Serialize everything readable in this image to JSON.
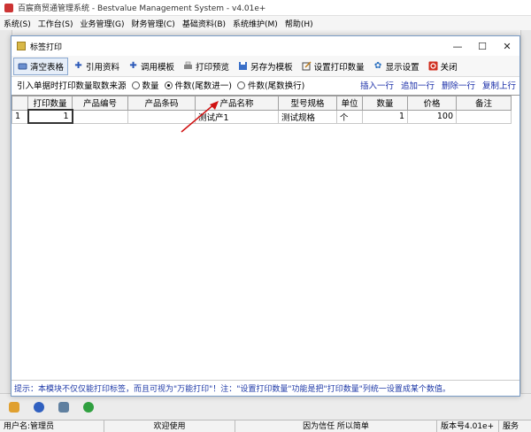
{
  "app": {
    "title": "百宸商贸通管理系统 - Bestvalue Management System - v4.01e+",
    "menu": [
      "系统(S)",
      "工作台(S)",
      "业务管理(G)",
      "财务管理(C)",
      "基础资料(B)",
      "系统维护(M)",
      "帮助(H)"
    ]
  },
  "dialog": {
    "title": "标签打印",
    "minimize": "—",
    "maximize": "☐",
    "close": "✕"
  },
  "toolbar": {
    "clear": "清空表格",
    "import": "引用资料",
    "template": "调用模板",
    "preview": "打印预览",
    "save_template": "另存为模板",
    "set_qty": "设置打印数量",
    "display": "显示设置",
    "close": "关闭"
  },
  "options": {
    "label": "引入单据时打印数量取数来源",
    "radio1": "数量",
    "radio2": "件数(尾数进一)",
    "radio3": "件数(尾数换行)",
    "link_insert": "插入一行",
    "link_append": "追加一行",
    "link_delete": "删除一行",
    "link_copy": "复制上行"
  },
  "table": {
    "headers": [
      "",
      "打印数量",
      "产品编号",
      "产品条码",
      "产品名称",
      "型号规格",
      "单位",
      "数量",
      "价格",
      "备注"
    ],
    "row": {
      "index": "1",
      "print_qty": "1",
      "code": "",
      "barcode": "",
      "name": "测试产1",
      "spec": "测试规格",
      "unit": "个",
      "qty": "1",
      "price": "100",
      "remark": ""
    }
  },
  "hint": "提示：本模块不仅仅能打印标签，而且可视为\"万能打印\"！注：\"设置打印数量\"功能是把\"打印数量\"列统一设置成某个数值。",
  "status": {
    "user": "用户名:管理员",
    "welcome": "欢迎使用",
    "slogan": "因为信任 所以简单",
    "version": "版本号4.01e+",
    "service": "服务"
  },
  "colors": {
    "link": "#1a2ea8",
    "hint": "#1f3aa8",
    "arrow": "#d01010"
  }
}
